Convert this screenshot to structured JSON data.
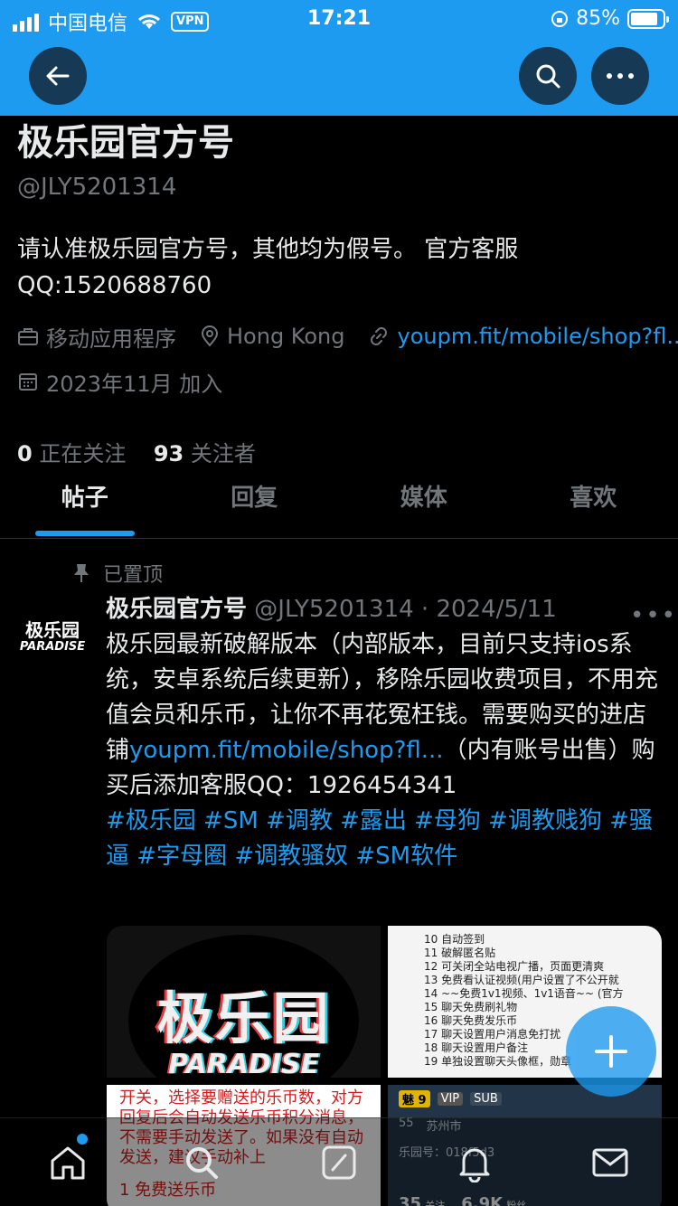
{
  "status_bar": {
    "carrier": "中国电信",
    "vpn": "VPN",
    "time": "17:21",
    "battery": "85%"
  },
  "header": {
    "back_icon": "arrow-left-icon",
    "search_icon": "search-icon",
    "more_icon": "more-icon"
  },
  "profile": {
    "name": "极乐园官方号",
    "handle": "@JLY5201314",
    "bio_line1": "请认准极乐园官方号，其他均为假号。 官方客服",
    "bio_line2": "QQ:1520688760",
    "category": "移动应用程序",
    "location": "Hong Kong",
    "link": "youpm.fit/mobile/shop?fl...",
    "joined": "2023年11月 加入",
    "following_count": "0",
    "following_label": "正在关注",
    "followers_count": "93",
    "followers_label": "关注者"
  },
  "tabs": [
    "帖子",
    "回复",
    "媒体",
    "喜欢"
  ],
  "post": {
    "pinned_label": "已置顶",
    "avatar_cn": "极乐园",
    "avatar_en": "PARADISE",
    "author": "极乐园官方号",
    "meta": " @JLY5201314 · 2024/5/11",
    "text_before_link": "极乐园最新破解版本（内部版本，目前只支持ios系统，安卓系统后续更新），移除乐园收费项目，不用充值会员和乐币，让你不再花冤枉钱。需要购买的进店铺",
    "link": "youpm.fit/mobile/shop?fl...",
    "text_after_link": "（内有账号出售）购买后添加客服QQ：1926454341",
    "tags": "#极乐园 #SM #调教 #露出 #母狗 #调教贱狗 #骚逼 #字母圈 #调教骚奴 #SM软件"
  },
  "media": {
    "logo_cn": "极乐园",
    "logo_en": "PARADISE",
    "list_lines": [
      "10  自动签到",
      "11  破解匿名贴",
      "12  可关闭全站电视广播，页面更清爽",
      "13  免费看认证视频(用户设置了不公开就",
      "14  ~~免费1v1视频、1v1语音~~  (官方",
      "15  聊天免费刷礼物",
      "16  聊天免费发乐币",
      "17  聊天设置用户消息免打扰",
      "18  聊天设置用户备注",
      "19  单独设置聊天头像框，勋章"
    ],
    "red_text": "开关，选择要赠送的乐币数，对方回复后会自动发送乐币积分消息，不需要手动发送了。如果没有自动发送，建议手动补上",
    "red_bottom": "1 免费送乐币",
    "card_level": "魅 9",
    "card_vip": "VIP",
    "card_sub": "SUB",
    "card_age": "55",
    "card_city": "苏州市",
    "card_id": "乐园号：018f5d3",
    "card_following": "35",
    "card_following_label": "关注",
    "card_fans": "6.9K",
    "card_fans_label": "粉丝"
  },
  "bottom_nav": [
    "home-icon",
    "search-icon",
    "grok-icon",
    "notifications-icon",
    "messages-icon"
  ]
}
